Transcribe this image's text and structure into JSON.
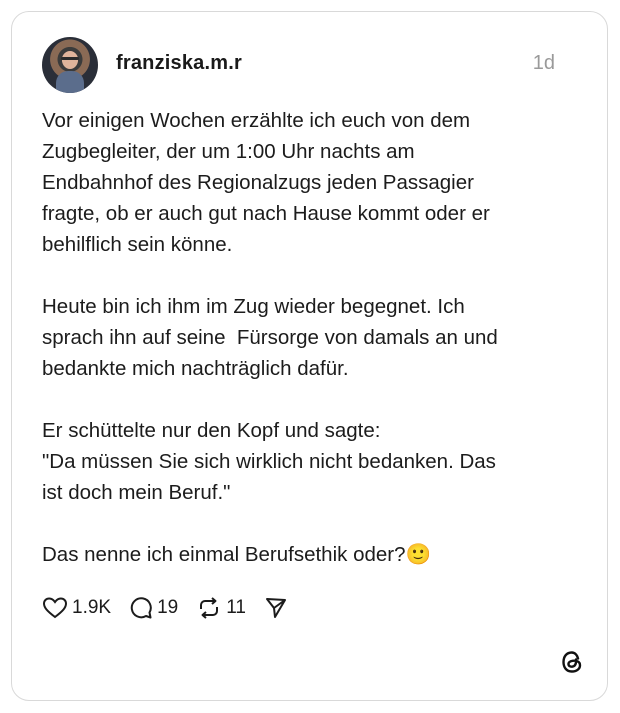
{
  "post": {
    "username": "franziska.m.r",
    "time": "1d",
    "text": "Vor einigen Wochen erzählte ich euch von dem\nZugbegleiter, der um 1:00 Uhr nachts am\nEndbahnhof des Regionalzugs jeden Passagier\nfragte, ob er auch gut nach Hause kommt oder er\nbehilflich sein könne.\n\nHeute bin ich ihm im Zug wieder begegnet. Ich\nsprach ihn auf seine  Fürsorge von damals an und\nbedankte mich nachträglich dafür.\n\nEr schüttelte nur den Kopf und sagte:\n\"Da müssen Sie sich wirklich nicht bedanken. Das\nist doch mein Beruf.\"\n\nDas nenne ich einmal Berufsethik oder?🙂"
  },
  "actions": {
    "likes": "1.9K",
    "comments": "19",
    "reposts": "11"
  },
  "icons": [
    "heart-icon",
    "comment-icon",
    "repost-icon",
    "share-icon",
    "threads-logo-icon"
  ]
}
